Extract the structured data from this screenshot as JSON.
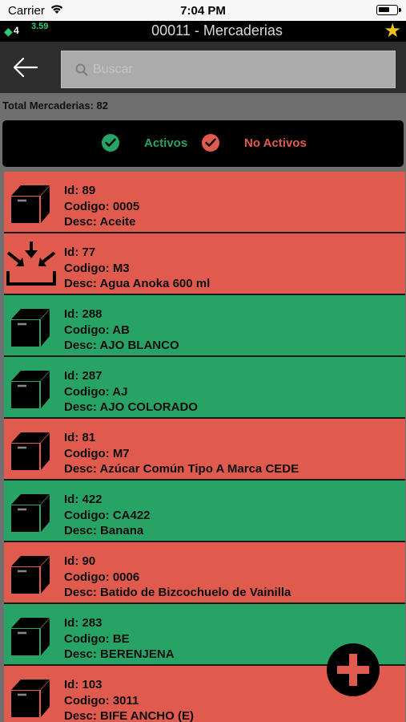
{
  "status_bar": {
    "carrier": "Carrier",
    "time": "7:04 PM"
  },
  "title_bar": {
    "badge_count": "4",
    "badge_value": "3.59",
    "title": "00011 - Mercaderias"
  },
  "search": {
    "placeholder": "Buscar",
    "value": ""
  },
  "summary": {
    "total_text": "Total Mercaderias: 82"
  },
  "filter": {
    "active_label": "Activos",
    "inactive_label": "No Activos",
    "active_color": "#27a465",
    "inactive_color": "#e05a4e"
  },
  "items": [
    {
      "id": "Id: 89",
      "codigo": "Codigo: 0005",
      "desc": "Desc: Aceite",
      "status": "red",
      "icon": "box-icon"
    },
    {
      "id": "Id: 77",
      "codigo": "Codigo: M3",
      "desc": "Desc: Agua Anoka 600 ml",
      "status": "red",
      "icon": "inbox-download-icon"
    },
    {
      "id": "Id: 288",
      "codigo": "Codigo: AB",
      "desc": "Desc: AJO BLANCO",
      "status": "green",
      "icon": "box-icon"
    },
    {
      "id": "Id: 287",
      "codigo": "Codigo: AJ",
      "desc": "Desc: AJO COLORADO",
      "status": "green",
      "icon": "box-icon"
    },
    {
      "id": "Id: 81",
      "codigo": "Codigo: M7",
      "desc": "Desc: Azúcar Común Tipo A Marca CEDE",
      "status": "red",
      "icon": "box-icon"
    },
    {
      "id": "Id: 422",
      "codigo": "Codigo: CA422",
      "desc": "Desc: Banana",
      "status": "green",
      "icon": "box-icon"
    },
    {
      "id": "Id: 90",
      "codigo": "Codigo: 0006",
      "desc": "Desc: Batido de Bizcochuelo de Vainilla",
      "status": "red",
      "icon": "box-icon"
    },
    {
      "id": "Id: 283",
      "codigo": "Codigo: BE",
      "desc": "Desc: BERENJENA",
      "status": "green",
      "icon": "box-icon"
    },
    {
      "id": "Id: 103",
      "codigo": "Codigo: 3011",
      "desc": "Desc: BIFE ANCHO (E)",
      "status": "red",
      "icon": "box-icon"
    }
  ]
}
